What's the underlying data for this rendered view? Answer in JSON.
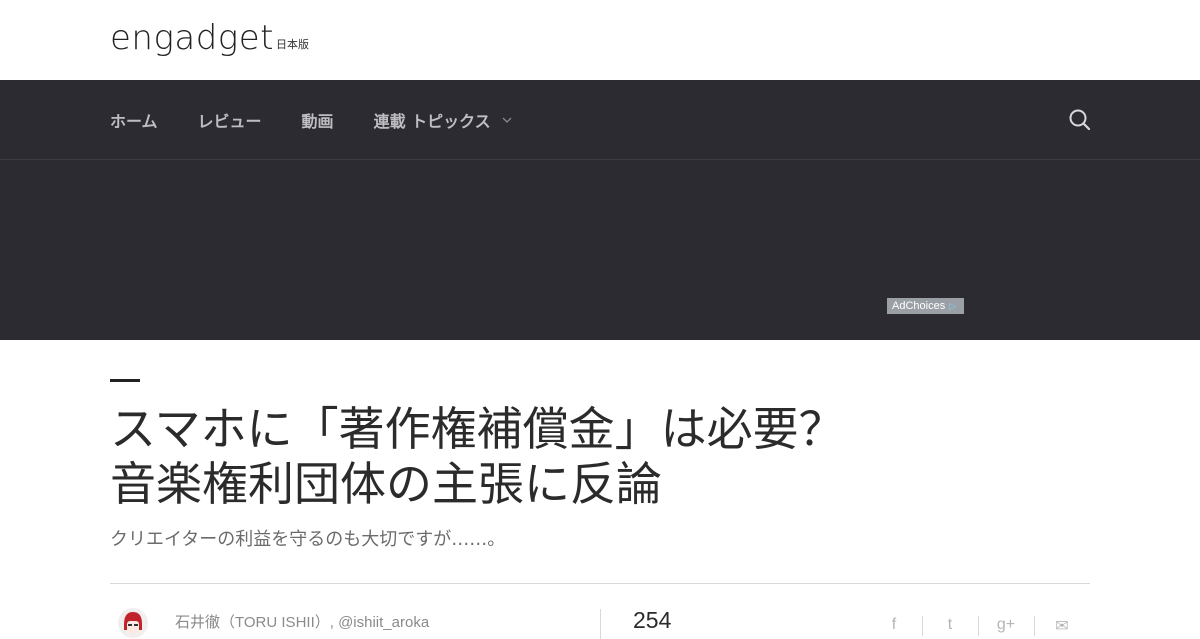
{
  "logo": {
    "wordmark": "engadget",
    "edition": "日本版"
  },
  "nav": {
    "items": [
      {
        "label": "ホーム"
      },
      {
        "label": "レビュー"
      },
      {
        "label": "動画"
      },
      {
        "label": "連載 トピックス"
      }
    ]
  },
  "ad": {
    "adchoices_label": "AdChoices"
  },
  "article": {
    "title_line1": "スマホに「著作権補償金」は必要？",
    "title_line2": "音楽権利団体の主張に反論",
    "subtitle": "クリエイターの利益を守るのも大切ですが……。",
    "author": "石井徹（TORU ISHII）, @ishiit_aroka",
    "share_count": "254"
  },
  "share": {
    "facebook": "f",
    "twitter": "t",
    "googleplus": "g+",
    "email": "✉"
  },
  "colors": {
    "nav_bg": "#2b2b31",
    "nav_text": "#bdbdc2",
    "text": "#2b2b2b",
    "muted": "#8a8a8a"
  }
}
